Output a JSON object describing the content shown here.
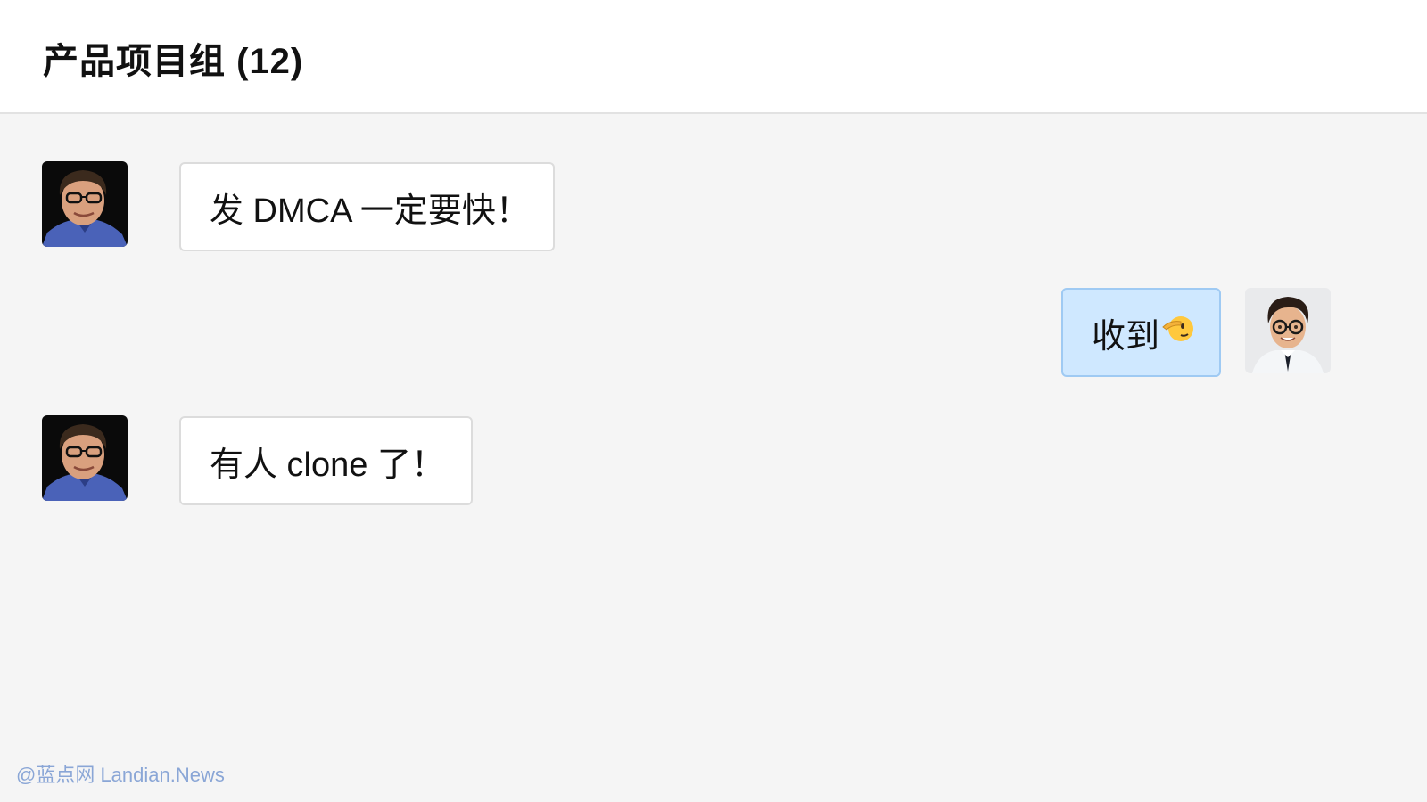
{
  "header": {
    "title": "产品项目组 (12)"
  },
  "messages": [
    {
      "side": "left",
      "sender_avatar": "man-with-glasses-photo-avatar",
      "text": "发 DMCA 一定要快！"
    },
    {
      "side": "right",
      "sender_avatar": "cartoon-man-with-glasses-avatar",
      "text": "收到",
      "emoji": "saluting-face-emoji"
    },
    {
      "side": "left",
      "sender_avatar": "man-with-glasses-photo-avatar",
      "text": "有人 clone 了！"
    }
  ],
  "watermark": {
    "text": "@蓝点网 Landian.News"
  },
  "colors": {
    "page_background": "#f5f5f5",
    "header_background": "#ffffff",
    "incoming_bubble": "#ffffff",
    "outgoing_bubble": "#cfe8ff",
    "outgoing_border": "#9fcaf3",
    "watermark": "#8aa6d6"
  }
}
